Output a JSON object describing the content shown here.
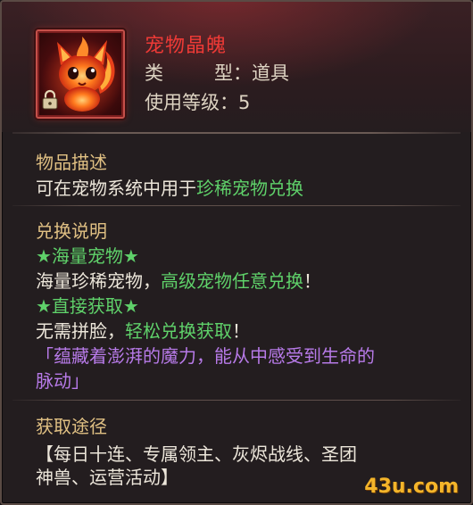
{
  "item": {
    "name": "宠物晶魄",
    "type_label": "类",
    "type_label_2": "型",
    "type_value": "道具",
    "level_label": "使用等级",
    "level_value": "5",
    "icon": "fire-pet-icon",
    "bound": true
  },
  "description": {
    "heading": "物品描述",
    "text_plain": "可在宠物系统中用于",
    "text_highlight": "珍稀宠物兑换"
  },
  "exchange": {
    "heading": "兑换说明",
    "tag1": "★海量宠物★",
    "line1_plain": "海量珍稀宠物，",
    "line1_highlight": "高级宠物任意兑换",
    "line1_end": "！",
    "tag2": "★直接获取★",
    "line2_plain": "无需拼脸，",
    "line2_highlight": "轻松兑换获取",
    "line2_end": "！",
    "flavor_line1": "「蕴藏着澎湃的魔力，能从中感受到生命的",
    "flavor_line2": "脉动」"
  },
  "source": {
    "heading": "获取途径",
    "line1": "【每日十连、专属领主、灰烬战线、圣团",
    "line2": "神兽、运营活动】"
  },
  "watermark": "43u.com",
  "colors": {
    "item_name": "#ee3a36",
    "section_heading": "#e0c083",
    "highlight_green": "#5fd16a",
    "flavor_purple": "#b77ae8",
    "frame_red": "#c5504a"
  }
}
